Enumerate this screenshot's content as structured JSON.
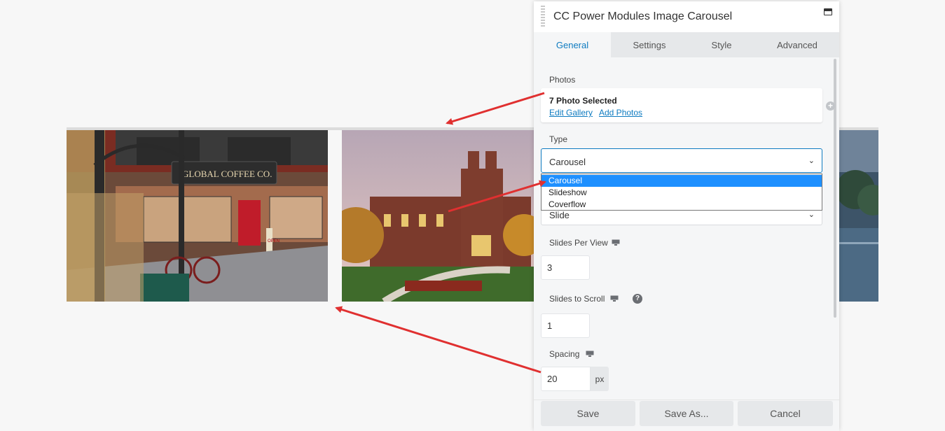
{
  "background": {
    "slide1_sign": "GLOBAL COFFEE CO.",
    "slide1_door": "OPEN"
  },
  "panel": {
    "title": "CC Power Modules Image Carousel",
    "tabs": [
      "General",
      "Settings",
      "Style",
      "Advanced"
    ],
    "active_tab": "General"
  },
  "photos": {
    "label": "Photos",
    "count_text": "7 Photo Selected",
    "edit_link": "Edit Gallery",
    "add_link": "Add Photos"
  },
  "type": {
    "label": "Type",
    "value": "Carousel",
    "options": [
      "Carousel",
      "Slideshow",
      "Coverflow"
    ]
  },
  "transition": {
    "value": "Slide"
  },
  "slides_per_view": {
    "label": "Slides Per View",
    "value": "3"
  },
  "slides_to_scroll": {
    "label": "Slides to Scroll",
    "value": "1"
  },
  "spacing": {
    "label": "Spacing",
    "value": "20",
    "unit": "px"
  },
  "footer": {
    "save": "Save",
    "save_as": "Save As...",
    "cancel": "Cancel"
  },
  "colors": {
    "accent": "#0e7bc0",
    "selection": "#1e90ff",
    "annotation_arrow": "#e03030"
  }
}
